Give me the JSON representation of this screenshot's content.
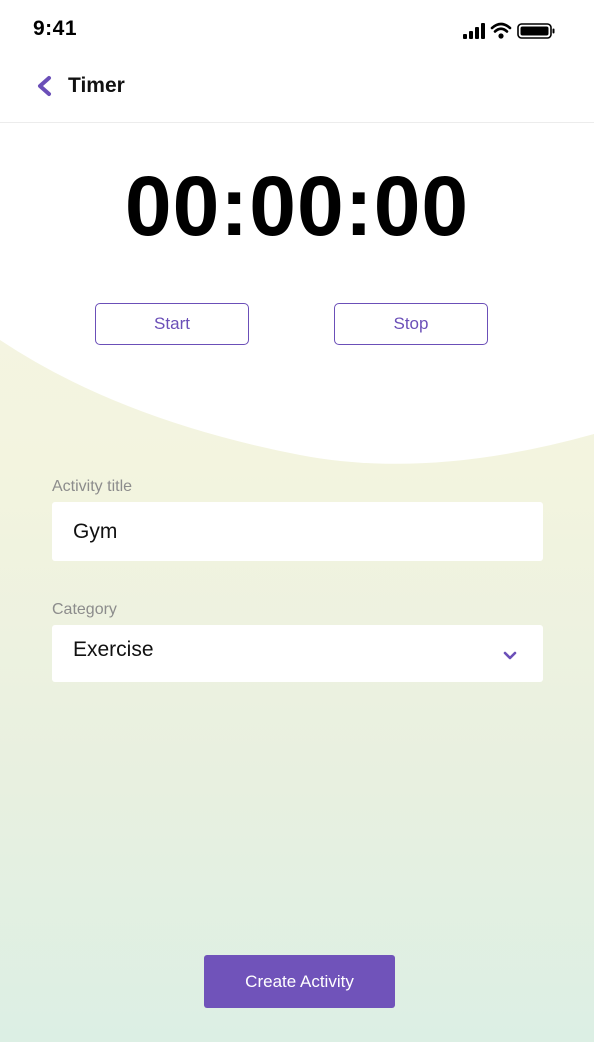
{
  "status_bar": {
    "time": "9:41",
    "icons": [
      "signal-icon",
      "wifi-icon",
      "battery-icon"
    ]
  },
  "nav": {
    "title": "Timer",
    "back_icon": "chevron-left-icon"
  },
  "timer": {
    "display": "00:00:00",
    "start_label": "Start",
    "stop_label": "Stop"
  },
  "form": {
    "activity_title_label": "Activity title",
    "activity_title_value": "Gym",
    "category_label": "Category",
    "category_value": "Exercise",
    "category_icon": "chevron-down-icon"
  },
  "actions": {
    "create_label": "Create Activity"
  },
  "colors": {
    "accent": "#6b4fb8",
    "primary_button": "#7053ba",
    "background_top": "#ffffff",
    "background_gradient_start": "#f5f6e6",
    "background_gradient_end": "#dcefe4"
  }
}
